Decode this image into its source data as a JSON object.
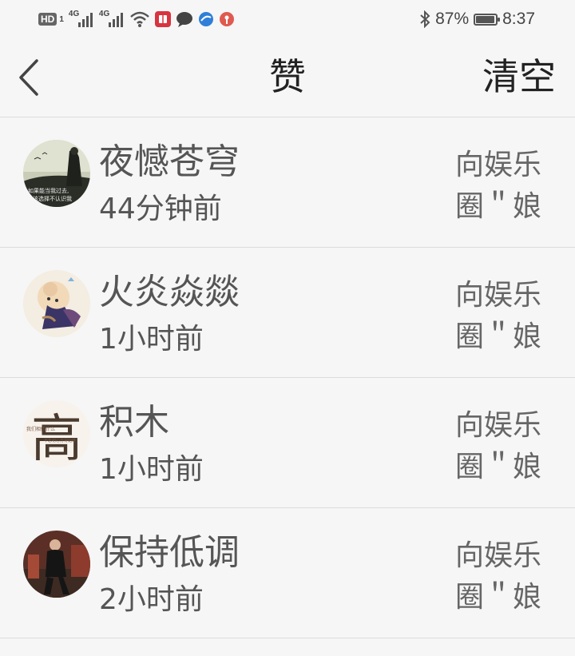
{
  "status_bar": {
    "hd_label": "HD",
    "sim1": "1",
    "net1": "4G",
    "net2": "4G",
    "battery_percent": "87%",
    "battery_level": 0.87,
    "time": "8:37",
    "icons": [
      "hd-icon",
      "signal-icon",
      "signal-icon",
      "wifi-icon",
      "book-app-icon",
      "chat-app-icon",
      "browser-app-icon",
      "podcast-app-icon",
      "bluetooth-icon",
      "battery-icon"
    ],
    "colors": {
      "book_app": "#d8343f",
      "chat_app": "#444444",
      "browser_app": "#2f7fd8",
      "podcast_app": "#e05a4f"
    }
  },
  "header": {
    "title": "赞",
    "clear_label": "清空",
    "back_icon": "chevron-left-icon"
  },
  "likes": [
    {
      "name": "夜憾苍穹",
      "time": "44分钟前",
      "source": "向娱乐圈＂娘"
    },
    {
      "name": "火炎焱燚",
      "time": "1小时前",
      "source": "向娱乐圈＂娘"
    },
    {
      "name": "积木",
      "time": "1小时前",
      "source": "向娱乐圈＂娘"
    },
    {
      "name": "保持低调",
      "time": "2小时前",
      "source": "向娱乐圈＂娘"
    }
  ],
  "avatar_texts": {
    "a1_line1": "如果能当我过去,",
    "a1_line2": "该选择不认识我",
    "a3_big": "高",
    "a3_line1": "我们相信什么",
    "a3_line2": "不忘初心方得始终"
  }
}
